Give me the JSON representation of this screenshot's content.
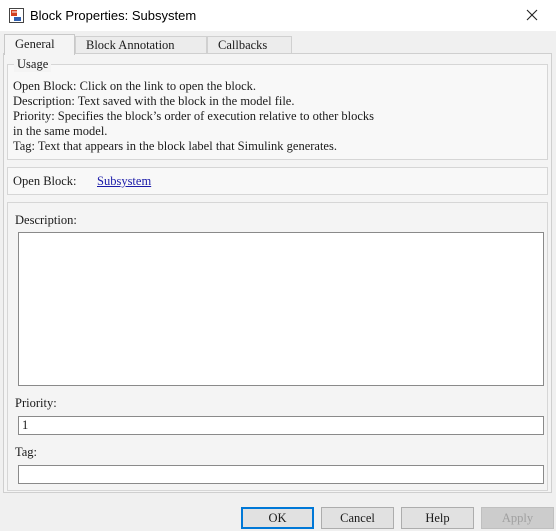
{
  "window": {
    "title": "Block Properties: Subsystem"
  },
  "tabs": [
    {
      "label": "General"
    },
    {
      "label": "Block Annotation"
    },
    {
      "label": "Callbacks"
    }
  ],
  "usage": {
    "legend": "Usage",
    "lines": [
      "Open Block: Click on the link to open the block.",
      "Description: Text saved with the block in the model file.",
      "Priority: Specifies the block’s order of execution relative to other blocks",
      "in the same model.",
      "Tag: Text that appears in the block label that Simulink generates."
    ]
  },
  "open_block": {
    "label": "Open Block:",
    "link": "Subsystem"
  },
  "description": {
    "label": "Description:",
    "value": ""
  },
  "priority": {
    "label": "Priority:",
    "value": "1"
  },
  "tag": {
    "label": "Tag:",
    "value": ""
  },
  "buttons": {
    "ok": "OK",
    "cancel": "Cancel",
    "help": "Help",
    "apply": "Apply"
  },
  "icons": {
    "app": "block-icon",
    "close": "close-icon"
  },
  "colors": {
    "link": "#1a1aa8",
    "default_button_border": "#0078d7"
  }
}
